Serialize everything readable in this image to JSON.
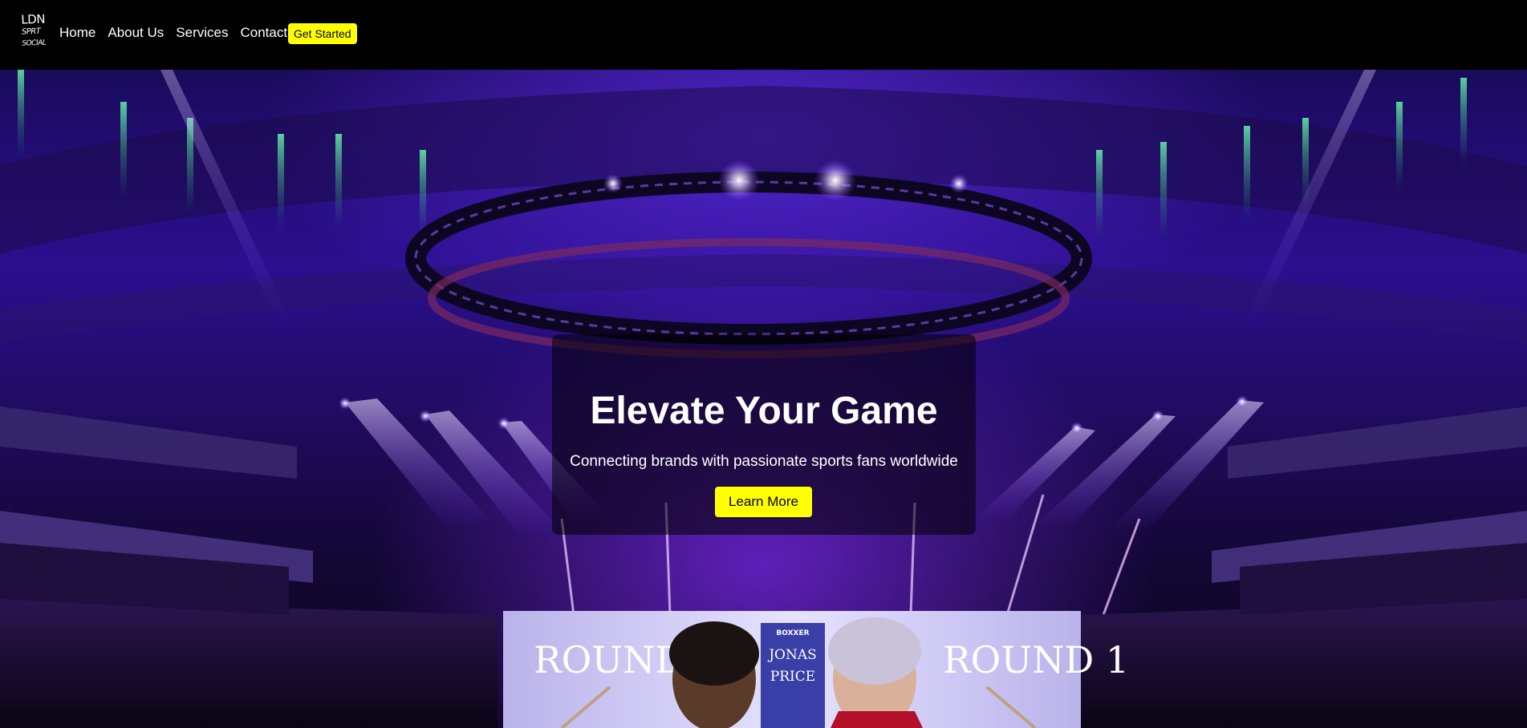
{
  "nav": {
    "logo_text_lines": [
      "LDN",
      "SPRT",
      "SOCIAL"
    ],
    "links": [
      "Home",
      "About Us",
      "Services",
      "Contact"
    ],
    "cta": "Get Started"
  },
  "hero": {
    "title": "Elevate Your Game",
    "subtitle": "Connecting brands with passionate sports fans worldwide",
    "button": "Learn More",
    "background_scene": {
      "screen_left_text": "ROUND 1",
      "screen_right_text": "ROUND 1",
      "screen_center_lines": [
        "JONAS",
        "PRICE"
      ],
      "screen_brand": "BOXXER"
    }
  },
  "colors": {
    "accent": "#ffff00",
    "nav_bg": "#000000",
    "hero_purple": "#2b0f8f"
  }
}
